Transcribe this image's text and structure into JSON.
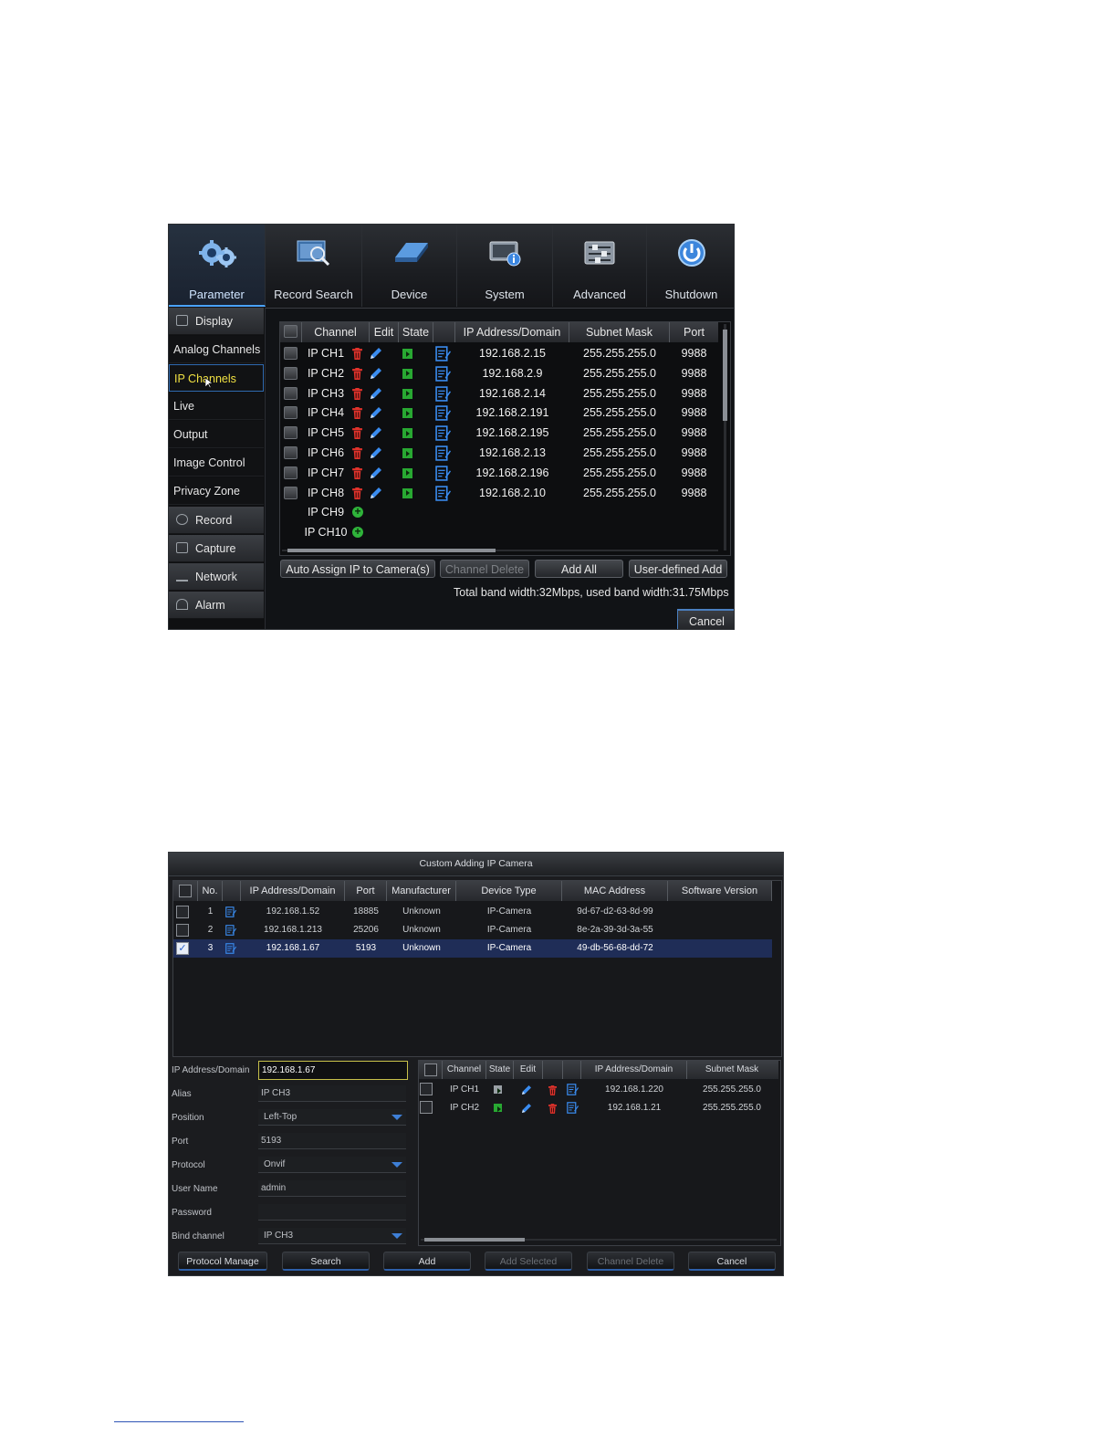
{
  "screenshot1": {
    "top_menu": [
      {
        "label": "Parameter",
        "icon": "gears-icon",
        "active": true
      },
      {
        "label": "Record Search",
        "icon": "film-search-icon"
      },
      {
        "label": "Device",
        "icon": "hdd-icon"
      },
      {
        "label": "System",
        "icon": "monitor-info-icon"
      },
      {
        "label": "Advanced",
        "icon": "sliders-icon"
      },
      {
        "label": "Shutdown",
        "icon": "power-icon"
      }
    ],
    "sidebar": [
      {
        "label": "Display",
        "type": "category"
      },
      {
        "label": "Analog Channels",
        "type": "sub"
      },
      {
        "label": "IP Channels",
        "type": "sub",
        "selected": true
      },
      {
        "label": "Live",
        "type": "sub"
      },
      {
        "label": "Output",
        "type": "sub"
      },
      {
        "label": "Image Control",
        "type": "sub"
      },
      {
        "label": "Privacy Zone",
        "type": "sub"
      },
      {
        "label": "Record",
        "type": "category"
      },
      {
        "label": "Capture",
        "type": "category"
      },
      {
        "label": "Network",
        "type": "category"
      },
      {
        "label": "Alarm",
        "type": "category"
      }
    ],
    "table": {
      "headers": [
        "Channel",
        "Edit",
        "State",
        "IP Address/Domain",
        "Subnet Mask",
        "Port"
      ],
      "rows": [
        {
          "channel": "IP CH1",
          "ip": "192.168.2.15",
          "mask": "255.255.255.0",
          "port": "9988"
        },
        {
          "channel": "IP CH2",
          "ip": "192.168.2.9",
          "mask": "255.255.255.0",
          "port": "9988"
        },
        {
          "channel": "IP CH3",
          "ip": "192.168.2.14",
          "mask": "255.255.255.0",
          "port": "9988"
        },
        {
          "channel": "IP CH4",
          "ip": "192.168.2.191",
          "mask": "255.255.255.0",
          "port": "9988"
        },
        {
          "channel": "IP CH5",
          "ip": "192.168.2.195",
          "mask": "255.255.255.0",
          "port": "9988"
        },
        {
          "channel": "IP CH6",
          "ip": "192.168.2.13",
          "mask": "255.255.255.0",
          "port": "9988"
        },
        {
          "channel": "IP CH7",
          "ip": "192.168.2.196",
          "mask": "255.255.255.0",
          "port": "9988"
        },
        {
          "channel": "IP CH8",
          "ip": "192.168.2.10",
          "mask": "255.255.255.0",
          "port": "9988"
        }
      ],
      "empty_rows": [
        "IP CH9",
        "IP CH10"
      ]
    },
    "buttons": {
      "auto_assign": "Auto Assign IP to Camera(s)",
      "channel_delete": "Channel Delete",
      "add_all": "Add All",
      "user_defined_add": "User-defined Add",
      "cancel": "Cancel"
    },
    "bandwidth": "Total band width:32Mbps, used band width:31.75Mbps",
    "colors": {
      "accent": "#4aa3ff",
      "selected_text": "#f0e142",
      "delete": "#e0322b",
      "state": "#28a832"
    }
  },
  "screenshot2": {
    "title": "Custom Adding IP Camera",
    "search_table": {
      "headers": [
        "No.",
        "IP Address/Domain",
        "Port",
        "Manufacturer",
        "Device Type",
        "MAC Address",
        "Software Version"
      ],
      "rows": [
        {
          "no": "1",
          "ip": "192.168.1.52",
          "port": "18885",
          "manufacturer": "Unknown",
          "type": "IP-Camera",
          "mac": "9d-67-d2-63-8d-99",
          "checked": false
        },
        {
          "no": "2",
          "ip": "192.168.1.213",
          "port": "25206",
          "manufacturer": "Unknown",
          "type": "IP-Camera",
          "mac": "8e-2a-39-3d-3a-55",
          "checked": false
        },
        {
          "no": "3",
          "ip": "192.168.1.67",
          "port": "5193",
          "manufacturer": "Unknown",
          "type": "IP-Camera",
          "mac": "49-db-56-68-dd-72",
          "checked": true
        }
      ]
    },
    "form": {
      "ip_label": "IP Address/Domain",
      "ip_value": "192.168.1.67",
      "alias_label": "Alias",
      "alias_value": "IP CH3",
      "position_label": "Position",
      "position_value": "Left-Top",
      "port_label": "Port",
      "port_value": "5193",
      "protocol_label": "Protocol",
      "protocol_value": "Onvif",
      "user_label": "User Name",
      "user_value": "admin",
      "password_label": "Password",
      "password_value": "",
      "bind_label": "Bind channel",
      "bind_value": "IP CH3"
    },
    "channel_table": {
      "headers": [
        "Channel",
        "State",
        "Edit",
        "IP Address/Domain",
        "Subnet Mask"
      ],
      "rows": [
        {
          "channel": "IP CH1",
          "ip": "192.168.1.220",
          "mask": "255.255.255.0"
        },
        {
          "channel": "IP CH2",
          "ip": "192.168.1.21",
          "mask": "255.255.255.0"
        }
      ]
    },
    "buttons": {
      "protocol_manage": "Protocol Manage",
      "search": "Search",
      "add": "Add",
      "add_selected": "Add Selected",
      "channel_delete": "Channel Delete",
      "cancel": "Cancel"
    }
  }
}
